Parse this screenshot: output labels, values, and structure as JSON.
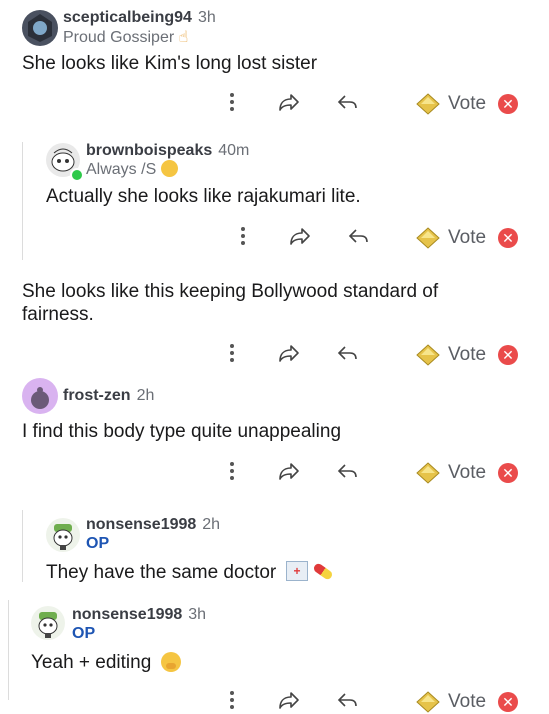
{
  "comments": [
    {
      "username": "scepticalbeing94",
      "time": "3h",
      "flair": "Proud Gossiper",
      "text": "She looks like Kim's long lost sister"
    },
    {
      "username": "brownboispeaks",
      "time": "40m",
      "flair": "Always /S",
      "text": "Actually she looks like rajakumari lite."
    },
    {
      "text_line1": "She looks like this keeping Bollywood standard of",
      "text_line2": "fairness."
    },
    {
      "username": "frost-zen",
      "time": "2h",
      "text": "I find this body type quite unappealing"
    },
    {
      "username": "nonsense1998",
      "time": "2h",
      "badge": "OP",
      "text": "They have the same doctor"
    },
    {
      "username": "nonsense1998",
      "time": "3h",
      "badge": "OP",
      "text": "Yeah + editing"
    }
  ],
  "actions": {
    "vote_label": "Vote"
  },
  "colors": {
    "accent_gold": "#e6c34a",
    "dismiss_red": "#ea4b4b",
    "op_blue": "#1e55b3"
  }
}
